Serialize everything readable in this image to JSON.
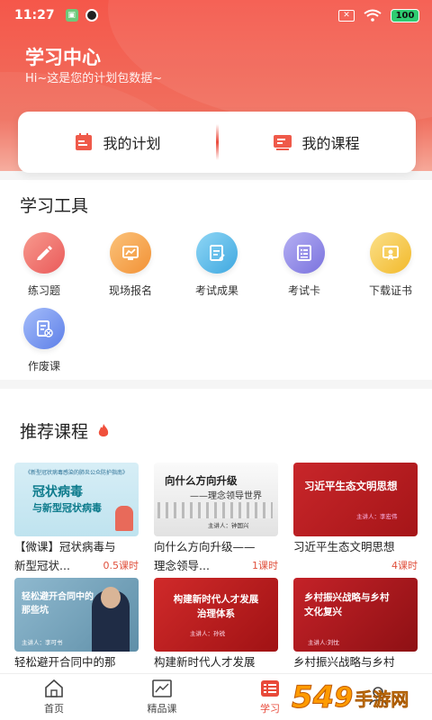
{
  "status_bar": {
    "time": "11:27",
    "battery": "100",
    "close_badge": "✕"
  },
  "header": {
    "title": "学习中心",
    "subtitle": "Hi~这是您的计划包数据~"
  },
  "plan_card": {
    "my_plan": "我的计划",
    "my_courses": "我的课程"
  },
  "tools": {
    "title": "学习工具",
    "items": [
      {
        "label": "练习题",
        "color": "#f06a6a"
      },
      {
        "label": "现场报名",
        "color": "#f5a04a"
      },
      {
        "label": "考试成果",
        "color": "#52b8e8"
      },
      {
        "label": "考试卡",
        "color": "#8c85e8"
      },
      {
        "label": "下载证书",
        "color": "#f5c540"
      },
      {
        "label": "作废课",
        "color": "#6a8df0"
      }
    ]
  },
  "recommend": {
    "title": "推荐课程",
    "courses": [
      {
        "line1": "【微课】冠状病毒与",
        "line2": "新型冠状...",
        "hours": "0.5课时",
        "thumb_top": "《新型冠状病毒感染的肺炎公众防护指南》",
        "thumb_main1": "冠状病毒",
        "thumb_main2": "与新型冠状病毒"
      },
      {
        "line1": "向什么方向升级——",
        "line2": "理念领导...",
        "hours": "1课时",
        "thumb_main1": "向什么方向升级",
        "thumb_main2": "——理念领导世界",
        "thumb_speaker": "主讲人：钟国兴"
      },
      {
        "line1": "习近平生态文明思想",
        "line2": "",
        "hours": "4课时",
        "thumb_main1": "习近平生态文明思想",
        "thumb_speaker": "主讲人：李宏伟"
      },
      {
        "line1": "轻松避开合同中的那",
        "line2": "",
        "thumb_main1": "轻松避开合同中的",
        "thumb_main2": "那些坑",
        "thumb_speaker": "主讲人：李可书"
      },
      {
        "line1": "构建新时代人才发展",
        "line2": "",
        "thumb_main1": "构建新时代人才发展",
        "thumb_main2": "治理体系",
        "thumb_speaker": "主讲人：孙锐"
      },
      {
        "line1": "乡村振兴战略与乡村",
        "line2": "",
        "thumb_main1": "乡村振兴战略与乡村",
        "thumb_main2": "文化复兴",
        "thumb_speaker": "主讲人:刘忱"
      }
    ]
  },
  "nav": {
    "home": "首页",
    "featured": "精品课",
    "study": "学习"
  },
  "watermark": {
    "num": "54",
    "text": "手游网",
    "suffix": "9"
  }
}
